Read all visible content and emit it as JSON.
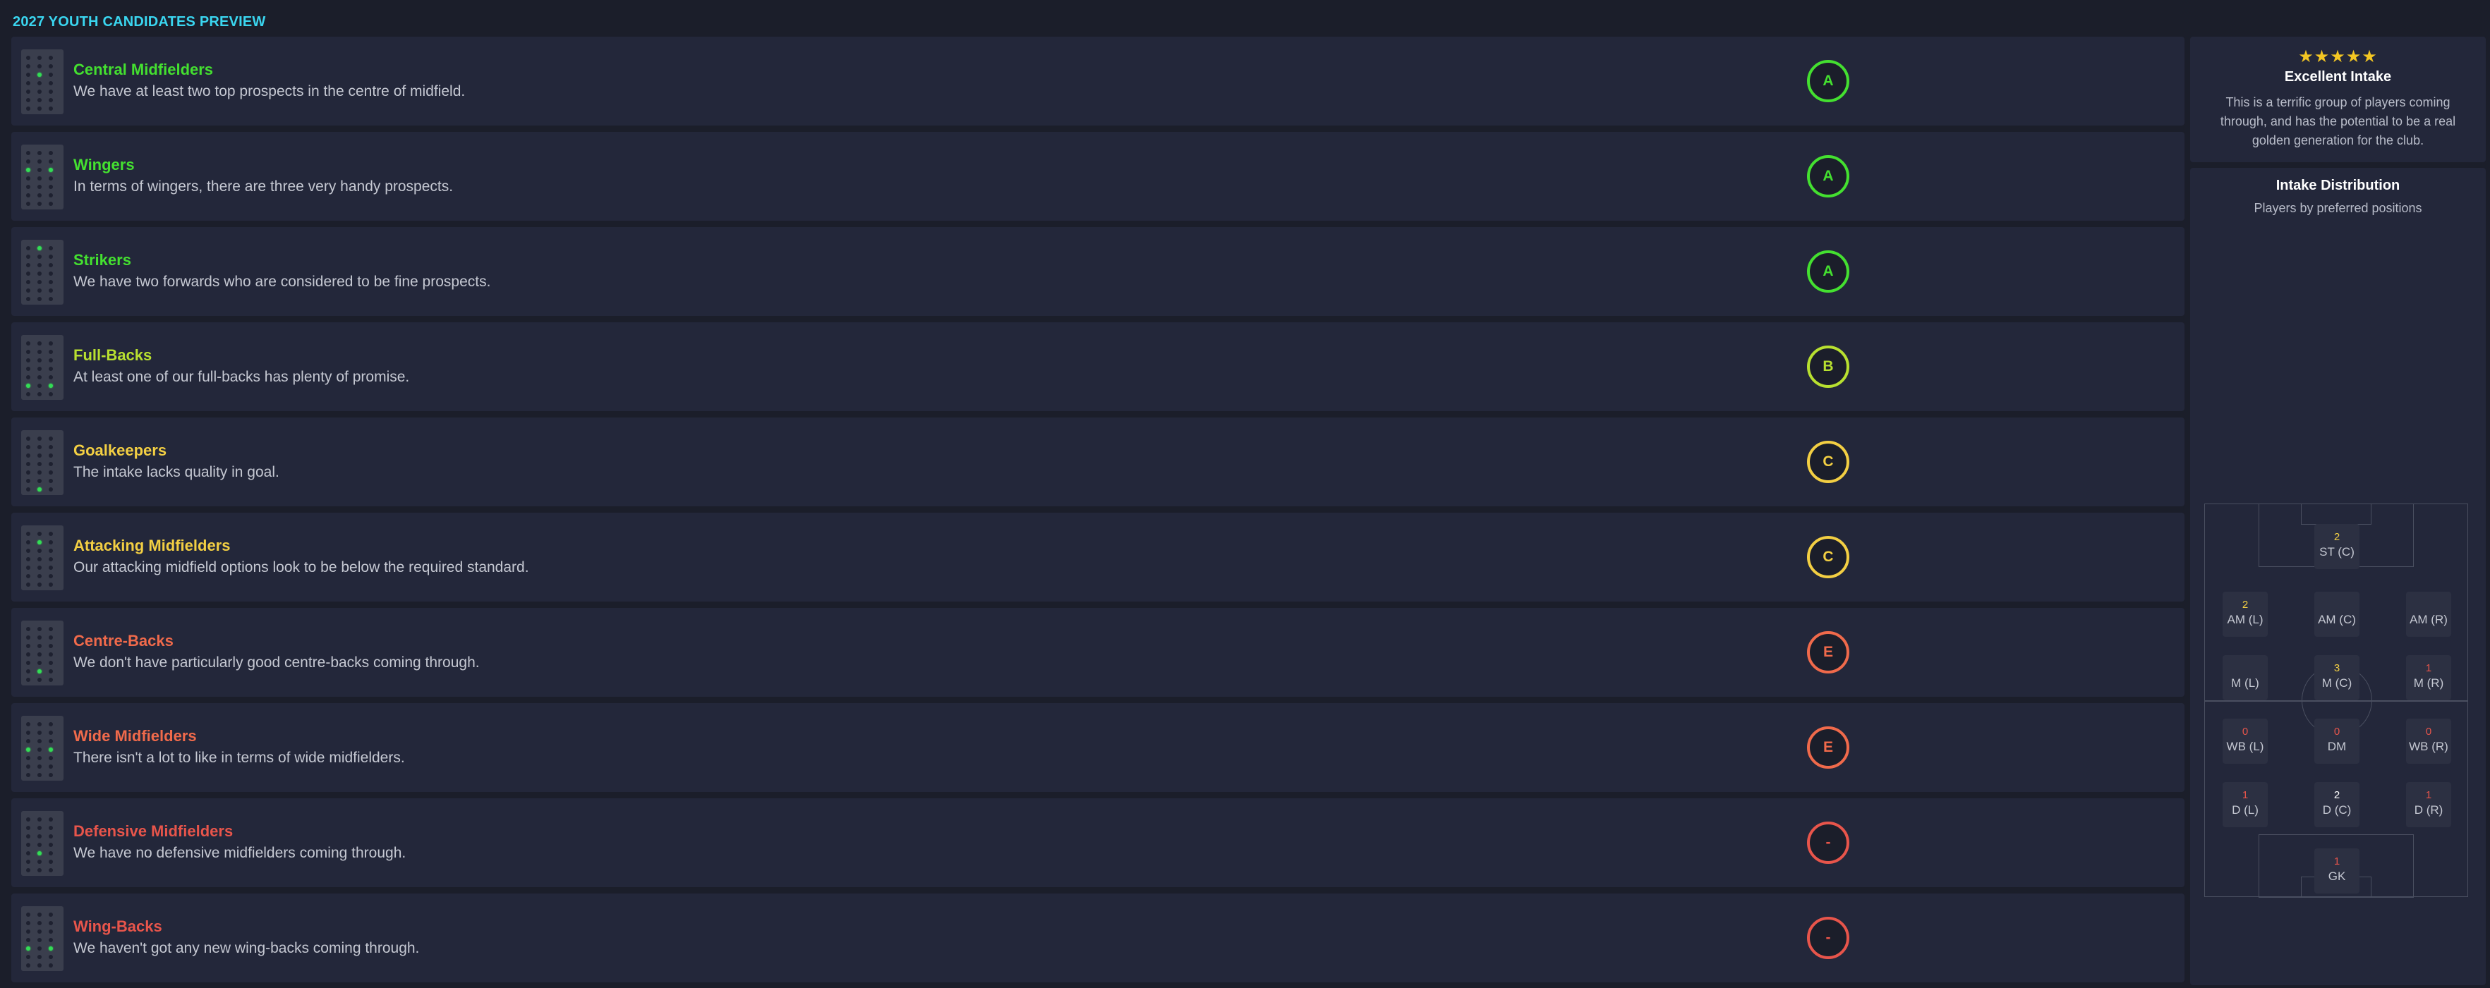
{
  "page_title": "2027 YOUTH CANDIDATES PREVIEW",
  "colors": {
    "grade_A": "#44e030",
    "grade_B": "#b8e030",
    "grade_C": "#f3cf43",
    "grade_E": "#f06a4b",
    "grade_none": "#e8554b"
  },
  "rows": [
    {
      "title": "Central Midfielders",
      "desc": "We have at least two top prospects in the centre of midfield.",
      "grade": "A",
      "grade_color": "#44e030",
      "title_color": "#44e030",
      "icon": "pitch-positions-icon"
    },
    {
      "title": "Wingers",
      "desc": "In terms of wingers, there are three very handy prospects.",
      "grade": "A",
      "grade_color": "#44e030",
      "title_color": "#44e030",
      "icon": "pitch-positions-icon"
    },
    {
      "title": "Strikers",
      "desc": "We have two forwards who are considered to be fine prospects.",
      "grade": "A",
      "grade_color": "#44e030",
      "title_color": "#44e030",
      "icon": "pitch-positions-icon"
    },
    {
      "title": "Full-Backs",
      "desc": "At least one of our full-backs has plenty of promise.",
      "grade": "B",
      "grade_color": "#b8e030",
      "title_color": "#b8e030",
      "icon": "pitch-positions-icon"
    },
    {
      "title": "Goalkeepers",
      "desc": "The intake lacks quality in goal.",
      "grade": "C",
      "grade_color": "#f3cf43",
      "title_color": "#f3cf43",
      "icon": "pitch-positions-icon"
    },
    {
      "title": "Attacking Midfielders",
      "desc": "Our attacking midfield options look to be below the required standard.",
      "grade": "C",
      "grade_color": "#f3cf43",
      "title_color": "#f3cf43",
      "icon": "pitch-positions-icon"
    },
    {
      "title": "Centre-Backs",
      "desc": "We don't have particularly good centre-backs coming through.",
      "grade": "E",
      "grade_color": "#f06a4b",
      "title_color": "#f06a4b",
      "icon": "pitch-positions-icon"
    },
    {
      "title": "Wide Midfielders",
      "desc": "There isn't a lot to like in terms of wide midfielders.",
      "grade": "E",
      "grade_color": "#f06a4b",
      "title_color": "#f06a4b",
      "icon": "pitch-positions-icon"
    },
    {
      "title": "Defensive Midfielders",
      "desc": "We have no defensive midfielders coming through.",
      "grade": "-",
      "grade_color": "#e8554b",
      "title_color": "#e8554b",
      "icon": "pitch-positions-icon"
    },
    {
      "title": "Wing-Backs",
      "desc": "We haven't got any new wing-backs coming through.",
      "grade": "-",
      "grade_color": "#e8554b",
      "title_color": "#e8554b",
      "icon": "pitch-positions-icon"
    }
  ],
  "summary": {
    "stars": "★★★★★",
    "rating_stars": 5,
    "title": "Excellent Intake",
    "desc": "This is a terrific group of players coming through, and has the potential to be a real golden generation for the club."
  },
  "distribution": {
    "title": "Intake Distribution",
    "subtitle": "Players by preferred positions",
    "positions": [
      {
        "label": "ST (C)",
        "count": "2",
        "count_color": "#f3cf43"
      },
      {
        "label": "AM (L)",
        "count": "2",
        "count_color": "#f3cf43"
      },
      {
        "label": "AM (C)",
        "count": "",
        "count_color": "#e8554b"
      },
      {
        "label": "AM (R)",
        "count": "",
        "count_color": "#e8554b"
      },
      {
        "label": "M (L)",
        "count": "",
        "count_color": "#e8554b"
      },
      {
        "label": "M (C)",
        "count": "3",
        "count_color": "#f3cf43"
      },
      {
        "label": "M (R)",
        "count": "1",
        "count_color": "#e8554b"
      },
      {
        "label": "WB (L)",
        "count": "0",
        "count_color": "#e8554b"
      },
      {
        "label": "DM",
        "count": "0",
        "count_color": "#e8554b"
      },
      {
        "label": "WB (R)",
        "count": "0",
        "count_color": "#e8554b"
      },
      {
        "label": "D (L)",
        "count": "1",
        "count_color": "#e8554b"
      },
      {
        "label": "D (C)",
        "count": "2",
        "count_color": "#ffffff"
      },
      {
        "label": "D (R)",
        "count": "1",
        "count_color": "#e8554b"
      },
      {
        "label": "GK",
        "count": "1",
        "count_color": "#e8554b"
      }
    ]
  }
}
